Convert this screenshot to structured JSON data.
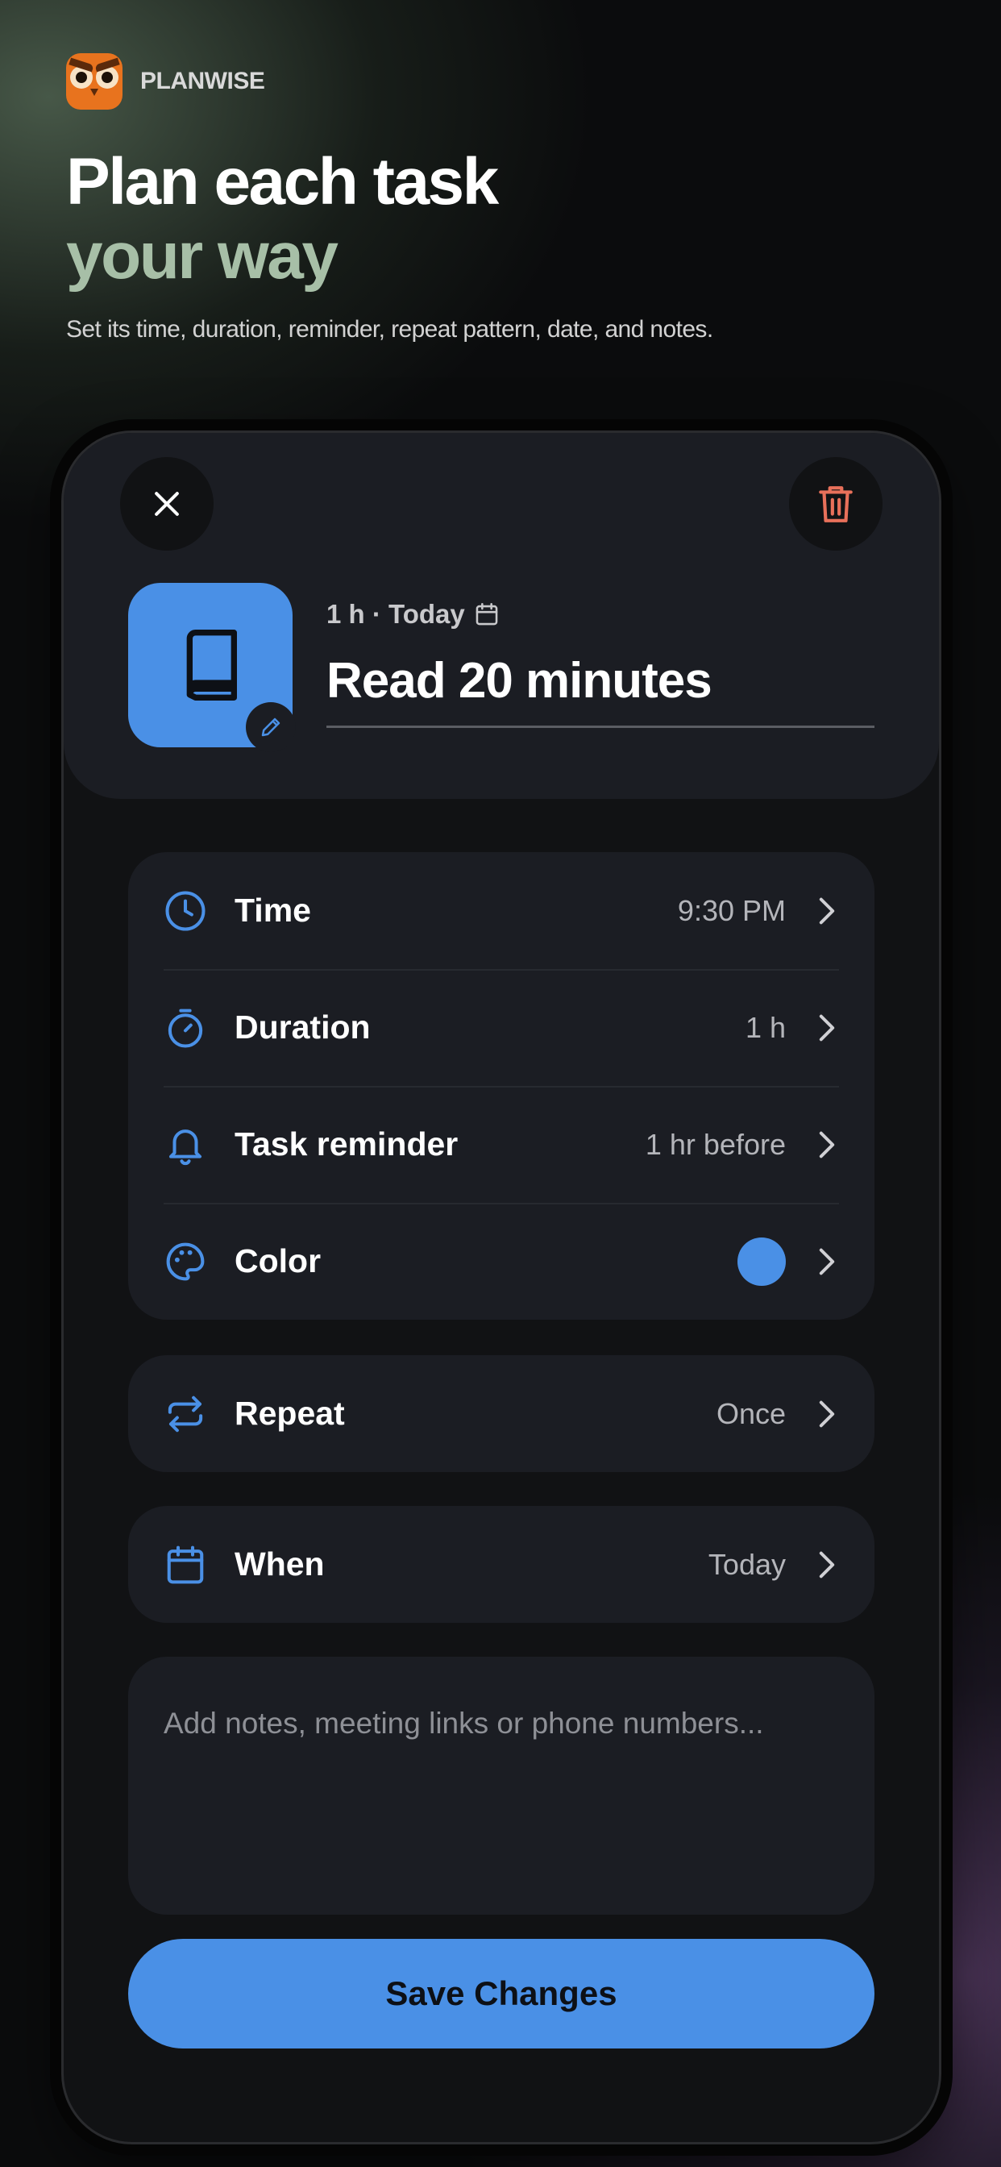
{
  "brand": {
    "name": "PLANWISE"
  },
  "hero": {
    "title_line1": "Plan each task",
    "title_line2": "your way",
    "subtitle": "Set its time, duration, reminder, repeat pattern, date, and notes."
  },
  "task": {
    "meta": "1 h · Today",
    "title": "Read 20 minutes",
    "icon": "book-icon",
    "color": "#4a90e6"
  },
  "settings": {
    "time": {
      "label": "Time",
      "value": "9:30 PM",
      "icon": "clock-icon"
    },
    "duration": {
      "label": "Duration",
      "value": "1 h",
      "icon": "stopwatch-icon"
    },
    "reminder": {
      "label": "Task reminder",
      "value": "1 hr before",
      "icon": "bell-icon"
    },
    "color": {
      "label": "Color",
      "value": "#4a90e6",
      "icon": "palette-icon"
    },
    "repeat": {
      "label": "Repeat",
      "value": "Once",
      "icon": "repeat-icon"
    },
    "when": {
      "label": "When",
      "value": "Today",
      "icon": "calendar-icon"
    }
  },
  "notes": {
    "placeholder": "Add notes, meeting links or phone numbers...",
    "value": ""
  },
  "actions": {
    "save_label": "Save Changes"
  },
  "colors": {
    "accent": "#4a90e6",
    "danger": "#e8705a",
    "card": "#1b1d23",
    "hero_secondary": "#a7bfa7"
  }
}
